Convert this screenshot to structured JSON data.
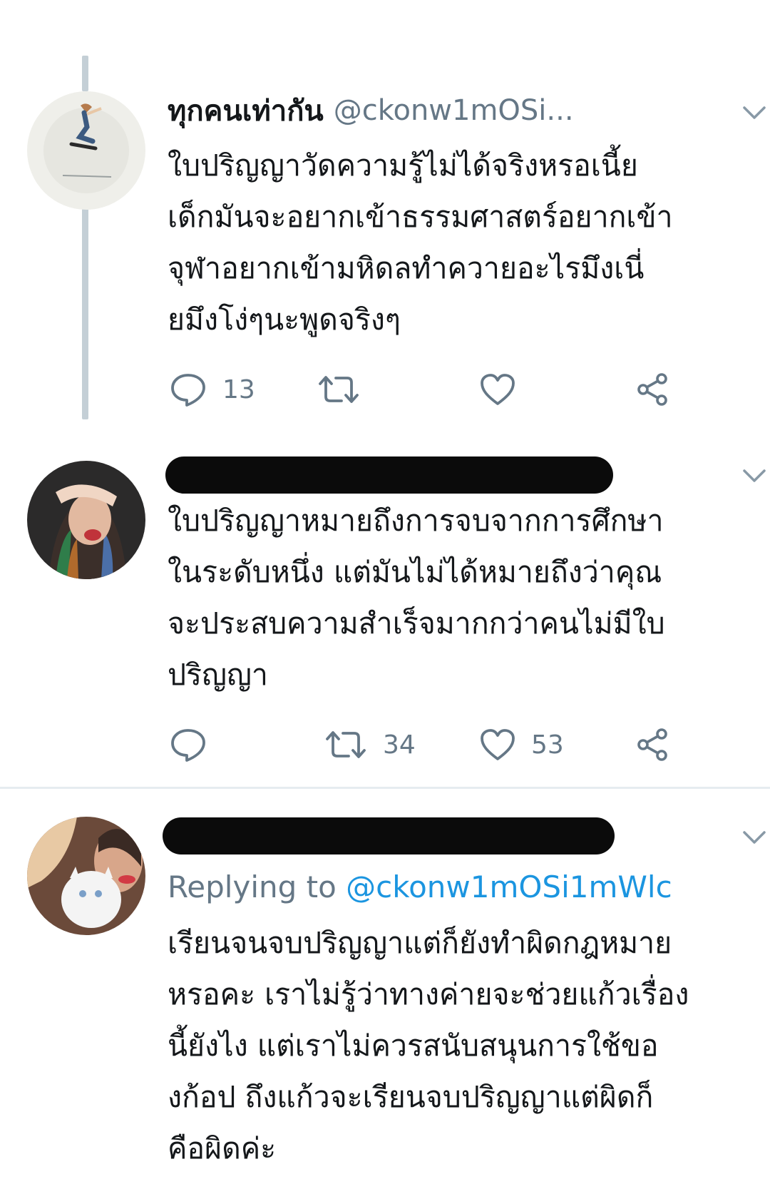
{
  "tweets": [
    {
      "display_name": "ทุกคนเท่ากัน",
      "handle": "@ckonw1mOSi...",
      "text_lines": [
        "ใบปริญญาวัดความรู้ไม่ได้จริงหรอเนี้ย",
        "เด็กมันจะอยากเข้าธรรมศาสตร์อยากเข้า",
        "จุฬาอยากเข้ามหิดลทำควายอะไรมึงเนี่",
        "ยมึงโง่ๆนะพูดจริงๆ"
      ],
      "reply_count": "13",
      "retweet_count": "",
      "like_count": ""
    },
    {
      "display_name": "",
      "handle": "",
      "text_lines": [
        "ใบปริญญาหมายถึงการจบจากการศึกษา",
        "ในระดับหนึ่ง แต่มันไม่ได้หมายถึงว่าคุณ",
        "จะประสบความสำเร็จมากกว่าคนไม่มีใบ",
        "ปริญญา"
      ],
      "reply_count": "",
      "retweet_count": "34",
      "like_count": "53"
    },
    {
      "display_name": "",
      "handle": "",
      "replying_prefix": "Replying to",
      "replying_to": "@ckonw1mOSi1mWlc",
      "text_lines": [
        "เรียนจนจบปริญญาแต่ก็ยังทำผิดกฎหมาย",
        "หรอคะ เราไม่รู้ว่าทางค่ายจะช่วยแก้วเรื่อง",
        "นี้ยังไง แต่เราไม่ควรสนับสนุนการใช้ขอ",
        "งก้อป ถึงแก้วจะเรียนจบปริญญาแต่ผิดก็",
        "คือผิดค่ะ"
      ]
    }
  ],
  "icons": {
    "reply": "reply-icon",
    "retweet": "retweet-icon",
    "like": "like-icon",
    "share": "share-icon",
    "menu": "chevron-down-icon"
  },
  "colors": {
    "text": "#14171a",
    "secondary": "#657786",
    "link": "#1b95e0",
    "thread_line": "#c4cfd6",
    "divider": "#e6ecf0",
    "redaction": "#0b0b0b"
  }
}
